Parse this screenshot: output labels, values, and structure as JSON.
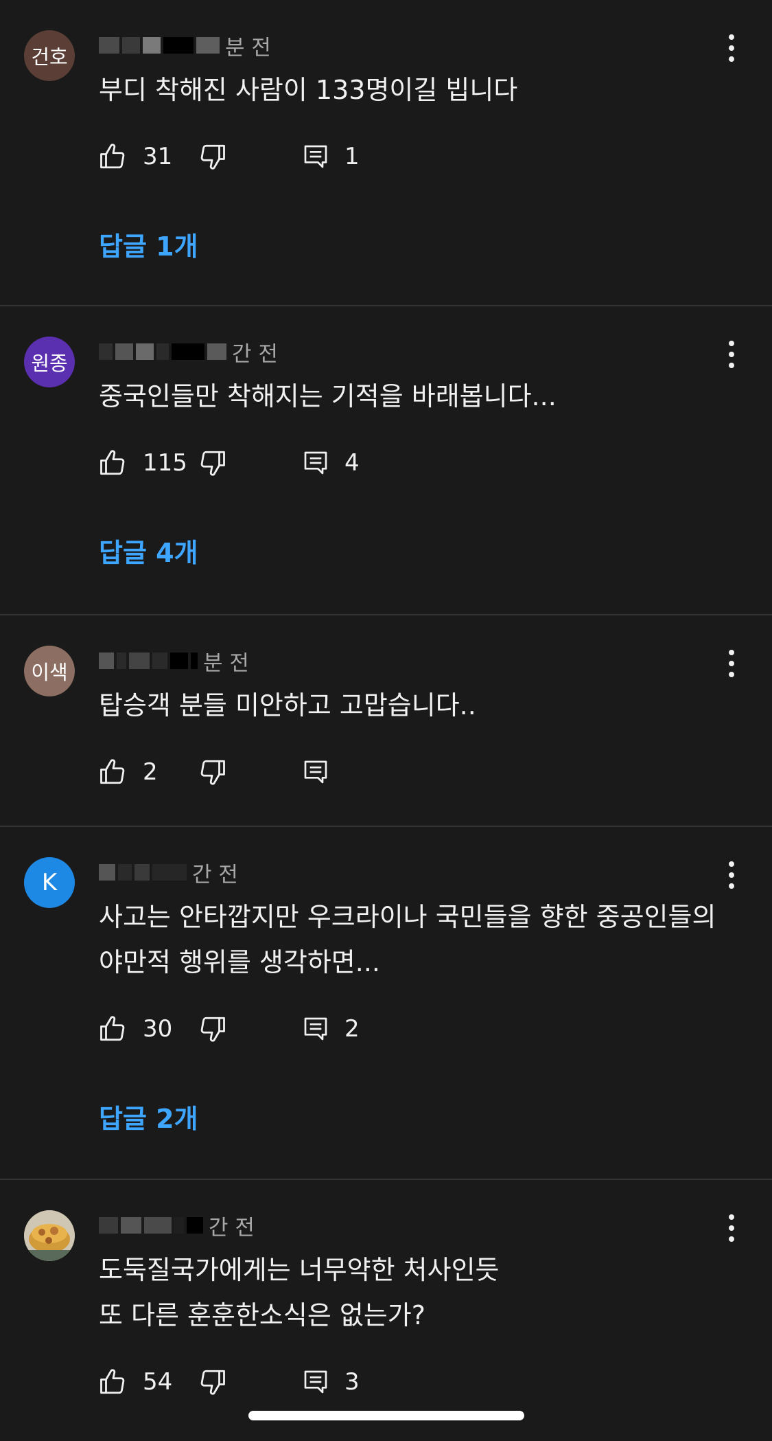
{
  "comments": [
    {
      "avatar": "건호",
      "avatar_color": "#5b3f36",
      "meta_suffix": "분 전",
      "text": "부디 착해진 사람이 133명이길 빕니다",
      "likes": "31",
      "reply_count": "1",
      "replies_label": "답글 1개"
    },
    {
      "avatar": "원종",
      "avatar_color": "#5a2fb0",
      "meta_suffix": "간 전",
      "text": "중국인들만 착해지는 기적을 바래봅니다...",
      "likes": "115",
      "reply_count": "4",
      "replies_label": "답글 4개"
    },
    {
      "avatar": "이색",
      "avatar_color": "#8d6e63",
      "meta_suffix": "분 전",
      "text": "탑승객 분들 미안하고 고맙습니다..",
      "likes": "2",
      "reply_count": "",
      "replies_label": ""
    },
    {
      "avatar": "K",
      "avatar_color": "#1e88e5",
      "meta_suffix": "간 전",
      "text": "사고는 안타깝지만 우크라이나 국민들을 향한 중공인들의\n야만적 행위를 생각하면...",
      "likes": "30",
      "reply_count": "2",
      "replies_label": "답글 2개"
    },
    {
      "avatar": "",
      "avatar_color": "#7a6a4c",
      "meta_suffix": "간 전",
      "text": "도둑질국가에게는 너무약한 처사인듯\n또 다른 훈훈한소식은 없는가?",
      "likes": "54",
      "reply_count": "3",
      "replies_label": ""
    }
  ],
  "icons": {
    "like": "thumbs-up-icon",
    "dislike": "thumbs-down-icon",
    "reply": "comment-icon",
    "more": "more-vert-icon"
  },
  "colors": {
    "background": "#1a1a1b",
    "link": "#3ea6ff",
    "divider": "#343436"
  }
}
